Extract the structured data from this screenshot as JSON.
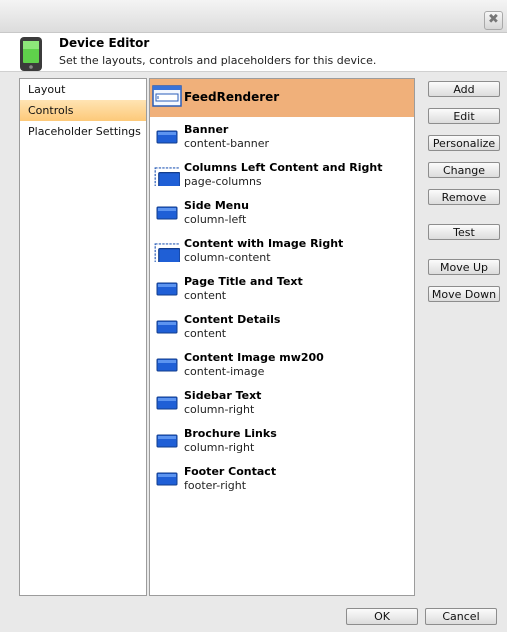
{
  "window": {
    "close_glyph": "✖"
  },
  "header": {
    "title": "Device Editor",
    "subtitle": "Set the layouts, controls and placeholders for this device.",
    "icon": "mobile-device-icon"
  },
  "nav": {
    "items": [
      {
        "label": "Layout",
        "active": false
      },
      {
        "label": "Controls",
        "active": true
      },
      {
        "label": "Placeholder Settings",
        "active": false
      }
    ]
  },
  "controls": {
    "selected": {
      "name": "FeedRenderer",
      "icon": "rendering-icon"
    },
    "items": [
      {
        "name": "Banner",
        "placeholder": "content-banner",
        "icon": "sublayout-icon"
      },
      {
        "name": "Columns Left Content and Right",
        "placeholder": "page-columns",
        "icon": "dashed-sublayout-icon"
      },
      {
        "name": "Side Menu",
        "placeholder": "column-left",
        "icon": "sublayout-icon"
      },
      {
        "name": "Content with Image Right",
        "placeholder": "column-content",
        "icon": "dashed-sublayout-icon"
      },
      {
        "name": "Page Title and Text",
        "placeholder": "content",
        "icon": "sublayout-icon"
      },
      {
        "name": "Content Details",
        "placeholder": "content",
        "icon": "sublayout-icon"
      },
      {
        "name": "Content Image mw200",
        "placeholder": "content-image",
        "icon": "sublayout-icon"
      },
      {
        "name": "Sidebar Text",
        "placeholder": "column-right",
        "icon": "sublayout-icon"
      },
      {
        "name": "Brochure Links",
        "placeholder": "column-right",
        "icon": "sublayout-icon"
      },
      {
        "name": "Footer Contact",
        "placeholder": "footer-right",
        "icon": "sublayout-icon"
      }
    ]
  },
  "buttons": {
    "add": "Add",
    "edit": "Edit",
    "personalize": "Personalize",
    "change": "Change",
    "remove": "Remove",
    "test": "Test",
    "move_up": "Move Up",
    "move_down": "Move Down"
  },
  "footer": {
    "ok": "OK",
    "cancel": "Cancel"
  },
  "colors": {
    "selected_row": "#f0b07a",
    "active_nav": "#fdc979",
    "icon_blue": "#1f5fd6"
  }
}
